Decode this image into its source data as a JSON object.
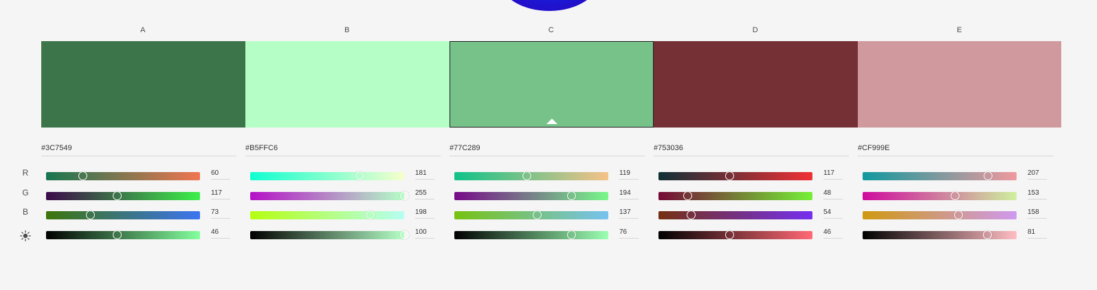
{
  "swatches": [
    {
      "label": "A",
      "color": "#3C7549",
      "hex": "#3C7549",
      "selected": false
    },
    {
      "label": "B",
      "color": "#B5FFC6",
      "hex": "#B5FFC6",
      "selected": false
    },
    {
      "label": "C",
      "color": "#77C289",
      "hex": "#77C289",
      "selected": true
    },
    {
      "label": "D",
      "color": "#753036",
      "hex": "#753036",
      "selected": false
    },
    {
      "label": "E",
      "color": "#CF999E",
      "hex": "#CF999E",
      "selected": false
    }
  ],
  "channel_labels": {
    "r": "R",
    "g": "G",
    "b": "B"
  },
  "sliders": [
    [
      {
        "channel": "R",
        "value": "60",
        "gradient": [
          "#177650",
          "#f07650"
        ],
        "fill": 0.235
      },
      {
        "channel": "G",
        "value": "117",
        "gradient": [
          "#3c0a49",
          "#3cf049"
        ],
        "fill": 0.458
      },
      {
        "channel": "B",
        "value": "73",
        "gradient": [
          "#3c7509",
          "#3c75f0"
        ],
        "fill": 0.285
      },
      {
        "channel": "brightness",
        "value": "46",
        "gradient": [
          "#000000",
          "#84ff9e"
        ],
        "fill": 0.46
      }
    ],
    [
      {
        "channel": "R",
        "value": "181",
        "gradient": [
          "#10ffd0",
          "#f6ffcd"
        ],
        "fill": 0.71
      },
      {
        "channel": "G",
        "value": "255",
        "gradient": [
          "#b510c6",
          "#b5ffc6"
        ],
        "fill": 1.0
      },
      {
        "channel": "B",
        "value": "198",
        "gradient": [
          "#b5ff10",
          "#b5fff2"
        ],
        "fill": 0.776
      },
      {
        "channel": "brightness",
        "value": "100",
        "gradient": [
          "#000000",
          "#b5ffc6"
        ],
        "fill": 1.0
      }
    ],
    [
      {
        "channel": "R",
        "value": "119",
        "gradient": [
          "#10c289",
          "#f6c289"
        ],
        "fill": 0.467
      },
      {
        "channel": "G",
        "value": "194",
        "gradient": [
          "#770a89",
          "#77f889"
        ],
        "fill": 0.761
      },
      {
        "channel": "B",
        "value": "137",
        "gradient": [
          "#77c210",
          "#77c2f0"
        ],
        "fill": 0.537
      },
      {
        "channel": "brightness",
        "value": "76",
        "gradient": [
          "#000000",
          "#9bffb2"
        ],
        "fill": 0.76
      }
    ],
    [
      {
        "channel": "R",
        "value": "117",
        "gradient": [
          "#0f3036",
          "#f03036"
        ],
        "fill": 0.459
      },
      {
        "channel": "G",
        "value": "48",
        "gradient": [
          "#750a36",
          "#75f036"
        ],
        "fill": 0.188
      },
      {
        "channel": "B",
        "value": "54",
        "gradient": [
          "#753010",
          "#7530f0"
        ],
        "fill": 0.212
      },
      {
        "channel": "brightness",
        "value": "46",
        "gradient": [
          "#000000",
          "#ff6975"
        ],
        "fill": 0.46
      }
    ],
    [
      {
        "channel": "R",
        "value": "207",
        "gradient": [
          "#10999e",
          "#f0999e"
        ],
        "fill": 0.812
      },
      {
        "channel": "G",
        "value": "153",
        "gradient": [
          "#cf0a9e",
          "#cff09e"
        ],
        "fill": 0.6
      },
      {
        "channel": "B",
        "value": "158",
        "gradient": [
          "#cf9910",
          "#cf99f0"
        ],
        "fill": 0.62
      },
      {
        "channel": "brightness",
        "value": "81",
        "gradient": [
          "#000000",
          "#ffbdc3"
        ],
        "fill": 0.81
      }
    ]
  ]
}
